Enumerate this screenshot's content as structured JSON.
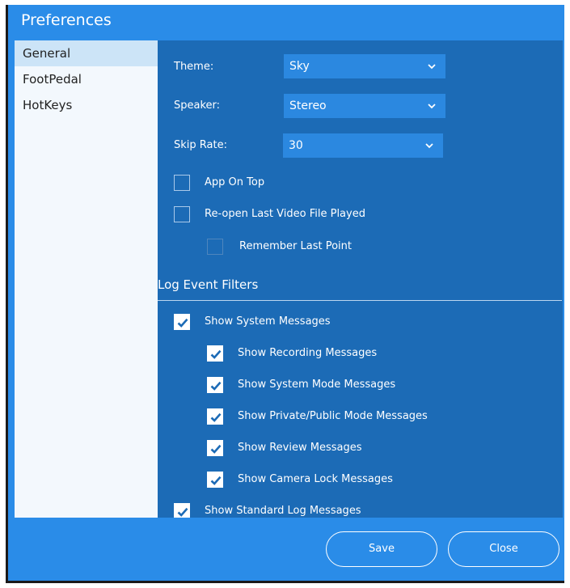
{
  "window": {
    "title": "Preferences"
  },
  "sidebar": {
    "items": [
      {
        "label": "General",
        "selected": true
      },
      {
        "label": "FootPedal",
        "selected": false
      },
      {
        "label": "HotKeys",
        "selected": false
      }
    ]
  },
  "general": {
    "theme": {
      "label": "Theme:",
      "value": "Sky"
    },
    "speaker": {
      "label": "Speaker:",
      "value": "Stereo"
    },
    "skip_rate": {
      "label": "Skip Rate:",
      "value": "30"
    },
    "app_on_top": {
      "label": "App On Top",
      "checked": false
    },
    "reopen_last_video": {
      "label": "Re-open Last Video File Played",
      "checked": false
    },
    "remember_last_point": {
      "label": "Remember Last Point",
      "checked": false,
      "enabled": false
    }
  },
  "log_filters": {
    "title": "Log Event Filters",
    "system_messages": {
      "label": "Show System Messages",
      "checked": true
    },
    "recording_messages": {
      "label": "Show Recording Messages",
      "checked": true
    },
    "system_mode_messages": {
      "label": "Show System Mode Messages",
      "checked": true
    },
    "private_public_messages": {
      "label": "Show Private/Public Mode Messages",
      "checked": true
    },
    "review_messages": {
      "label": "Show Review Messages",
      "checked": true
    },
    "camera_lock_messages": {
      "label": "Show Camera Lock Messages",
      "checked": true
    },
    "standard_log_messages": {
      "label": "Show Standard Log Messages",
      "checked": true
    }
  },
  "buttons": {
    "save": "Save",
    "close": "Close"
  },
  "colors": {
    "title_bar": "#2a8ce8",
    "panel": "#1c6bb6",
    "sidebar": "#f3f8fd",
    "selected_item": "#cce4f7",
    "dropdown": "#2b88e0"
  }
}
